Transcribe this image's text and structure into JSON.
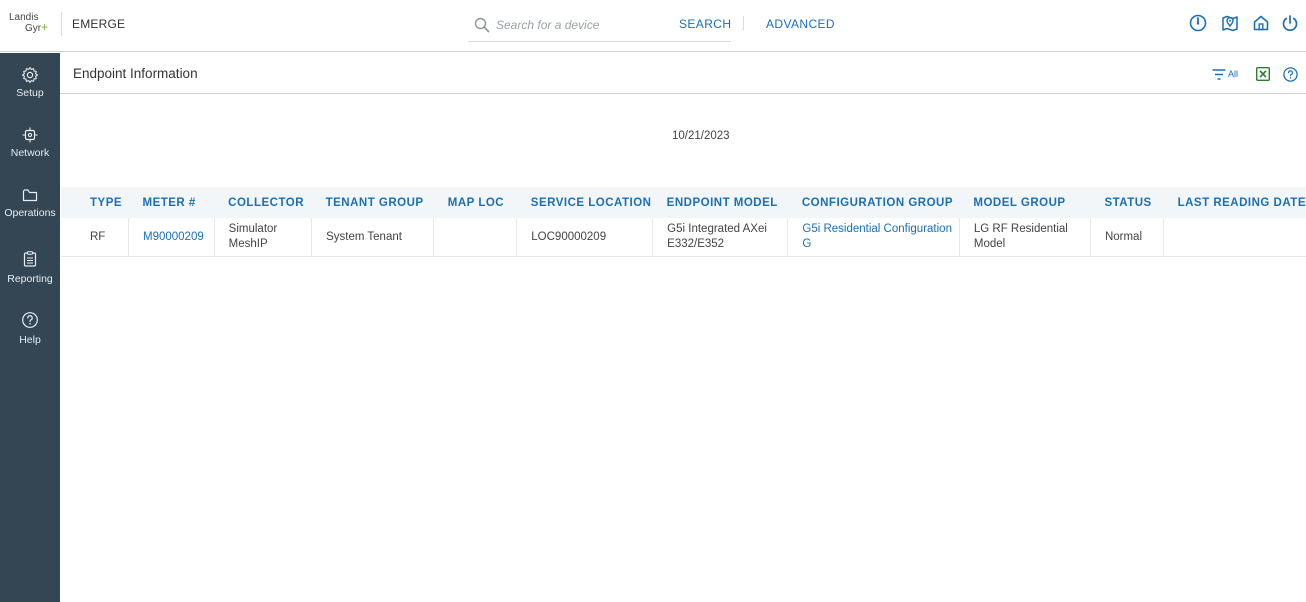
{
  "header": {
    "logo_line1": "Landis",
    "logo_line2": "Gyr",
    "logo_plus": "+",
    "app_name": "EMERGE",
    "search_placeholder": "Search for a device",
    "search_label": "SEARCH",
    "advanced_label": "ADVANCED",
    "icons": [
      "dashboard-gauge-icon",
      "map-pin-icon",
      "home-icon",
      "power-icon"
    ]
  },
  "sidebar": {
    "items": [
      {
        "label": "Setup",
        "icon": "gear-icon"
      },
      {
        "label": "Network",
        "icon": "network-icon"
      },
      {
        "label": "Operations",
        "icon": "folder-icon"
      },
      {
        "label": "Reporting",
        "icon": "clipboard-icon"
      },
      {
        "label": "Help",
        "icon": "question-circle-icon"
      }
    ]
  },
  "page": {
    "title": "Endpoint Information",
    "filter_label": "All",
    "date": "10/21/2023"
  },
  "table": {
    "headers": [
      "TYPE",
      "METER #",
      "COLLECTOR",
      "TENANT GROUP",
      "MAP LOC",
      "SERVICE LOCATION",
      "ENDPOINT MODEL",
      "CONFIGURATION GROUP",
      "MODEL GROUP",
      "STATUS",
      "LAST READING DATE"
    ],
    "rows": [
      {
        "type": "RF",
        "meter": "M90000209",
        "collector": "Simulator MeshIP",
        "tenant_group": "System Tenant",
        "map_loc": "",
        "service_location": "LOC90000209",
        "endpoint_model": "G5i Integrated AXei E332/E352",
        "configuration_group": "G5i Residential Configuration G",
        "model_group": "LG RF Residential Model",
        "status": "Normal",
        "last_reading_date": ""
      }
    ]
  },
  "colors": {
    "accent": "#1b6fb5",
    "sidebar": "#344553",
    "logo_plus": "#6ab23e",
    "excel": "#2e7d32"
  }
}
